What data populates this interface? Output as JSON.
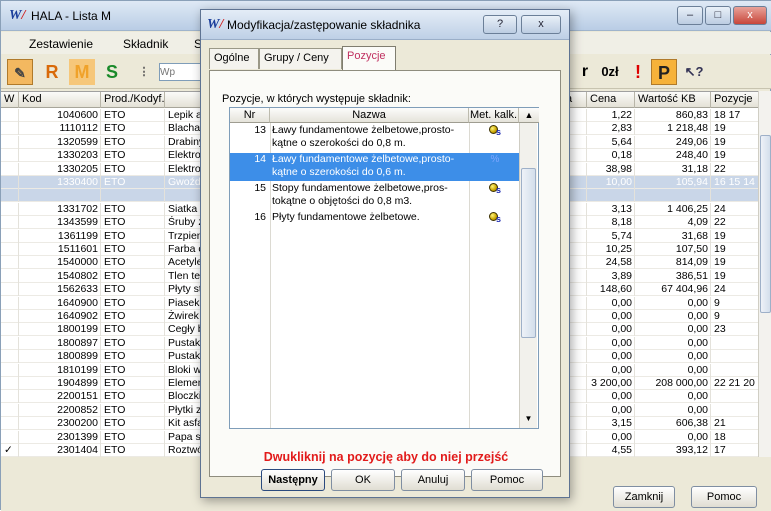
{
  "main": {
    "title": "HALA - Lista M",
    "menu": [
      "Zestawienie",
      "Składnik",
      "S"
    ],
    "toolbar": {
      "r_label": "R",
      "m_label": "M",
      "s_label": "S",
      "search_placeholder": "Wp",
      "right_r": "r",
      "currency": "0zł",
      "exclaim": "!",
      "p_label": "P",
      "help_glyph": "?"
    },
    "columns": [
      "W",
      "Kod",
      "Prod./Kodyf.",
      "",
      "a",
      "Cena",
      "Wartość KB",
      "Pozycje"
    ],
    "rows": [
      {
        "w": "",
        "kod": "1040600",
        "prod": "ETO",
        "name": "Lepik as",
        "a": "",
        "cena": "1,22",
        "wartosc": "860,83",
        "poz": "18 17"
      },
      {
        "w": "",
        "kod": "1110112",
        "prod": "ETO",
        "name": "Blacha",
        "a": "",
        "cena": "2,83",
        "wartosc": "1 218,48",
        "poz": "19"
      },
      {
        "w": "",
        "kod": "1320599",
        "prod": "ETO",
        "name": "Drabiny",
        "a": "",
        "cena": "5,64",
        "wartosc": "249,06",
        "poz": "19"
      },
      {
        "w": "",
        "kod": "1330203",
        "prod": "ETO",
        "name": "Elektrod",
        "a": "",
        "cena": "0,18",
        "wartosc": "248,40",
        "poz": "19"
      },
      {
        "w": "",
        "kod": "1330205",
        "prod": "ETO",
        "name": "Elektrod",
        "a": "",
        "cena": "38,98",
        "wartosc": "31,18",
        "poz": "22"
      },
      {
        "w": "",
        "kod": "1330400",
        "prod": "ETO",
        "name": "Gwoździ",
        "a": "",
        "cena": "10,00",
        "wartosc": "105,94",
        "poz": "16 15 14",
        "sel": true
      },
      {
        "w": "",
        "kod": "",
        "prod": "",
        "name": "",
        "a": "",
        "cena": "",
        "wartosc": "",
        "poz": "",
        "sel": true
      },
      {
        "w": "",
        "kod": "1331702",
        "prod": "ETO",
        "name": "Siatka F",
        "a": "",
        "cena": "3,13",
        "wartosc": "1 406,25",
        "poz": "24"
      },
      {
        "w": "",
        "kod": "1343599",
        "prod": "ETO",
        "name": "Śruby z",
        "a": "",
        "cena": "8,18",
        "wartosc": "4,09",
        "poz": "22"
      },
      {
        "w": "",
        "kod": "1361199",
        "prod": "ETO",
        "name": "Trzpieni",
        "a": "",
        "cena": "5,74",
        "wartosc": "31,68",
        "poz": "19"
      },
      {
        "w": "",
        "kod": "1511601",
        "prod": "ETO",
        "name": "Farba o",
        "a": "",
        "cena": "10,25",
        "wartosc": "107,50",
        "poz": "19"
      },
      {
        "w": "",
        "kod": "1540000",
        "prod": "ETO",
        "name": "Acetyler",
        "a": "",
        "cena": "24,58",
        "wartosc": "814,09",
        "poz": "19"
      },
      {
        "w": "",
        "kod": "1540802",
        "prod": "ETO",
        "name": "Tlen tec",
        "a": "",
        "cena": "3,89",
        "wartosc": "386,51",
        "poz": "19"
      },
      {
        "w": "",
        "kod": "1562633",
        "prod": "ETO",
        "name": "Płyty st",
        "a": "",
        "cena": "148,60",
        "wartosc": "67 404,96",
        "poz": "24"
      },
      {
        "w": "",
        "kod": "1640900",
        "prod": "ETO",
        "name": "Piasek",
        "a": "",
        "cena": "0,00",
        "wartosc": "0,00",
        "poz": "9"
      },
      {
        "w": "",
        "kod": "1640902",
        "prod": "ETO",
        "name": "Żwirek",
        "a": "",
        "cena": "0,00",
        "wartosc": "0,00",
        "poz": "9"
      },
      {
        "w": "",
        "kod": "1800199",
        "prod": "ETO",
        "name": "Cegły b",
        "a": "",
        "cena": "0,00",
        "wartosc": "0,00",
        "poz": "23"
      },
      {
        "w": "",
        "kod": "1800897",
        "prod": "ETO",
        "name": "Pustaki",
        "a": "",
        "cena": "0,00",
        "wartosc": "0,00",
        "poz": ""
      },
      {
        "w": "",
        "kod": "1800899",
        "prod": "ETO",
        "name": "Pustaki",
        "a": "",
        "cena": "0,00",
        "wartosc": "0,00",
        "poz": ""
      },
      {
        "w": "",
        "kod": "1810199",
        "prod": "ETO",
        "name": "Bloki wa",
        "a": "",
        "cena": "0,00",
        "wartosc": "0,00",
        "poz": ""
      },
      {
        "w": "",
        "kod": "1904899",
        "prod": "ETO",
        "name": "Element",
        "a": "",
        "cena": "3 200,00",
        "wartosc": "208 000,00",
        "poz": "22 21 20"
      },
      {
        "w": "",
        "kod": "2200151",
        "prod": "ETO",
        "name": "Bloczki",
        "a": "",
        "cena": "0,00",
        "wartosc": "0,00",
        "poz": ""
      },
      {
        "w": "",
        "kod": "2200852",
        "prod": "ETO",
        "name": "Płytki z",
        "a": "",
        "cena": "0,00",
        "wartosc": "0,00",
        "poz": ""
      },
      {
        "w": "",
        "kod": "2300200",
        "prod": "ETO",
        "name": "Kit asfal",
        "a": "",
        "cena": "3,15",
        "wartosc": "606,38",
        "poz": "21"
      },
      {
        "w": "",
        "kod": "2301399",
        "prod": "ETO",
        "name": "Papa sn",
        "a": "",
        "cena": "0,00",
        "wartosc": "0,00",
        "poz": "18"
      },
      {
        "w": "✓",
        "kod": "2301404",
        "prod": "ETO",
        "name": "Roztwó",
        "a": "",
        "cena": "4,55",
        "wartosc": "393,12",
        "poz": "17"
      }
    ],
    "buttons": {
      "zamknij": "Zamknij",
      "pomoc": "Pomoc"
    }
  },
  "dialog": {
    "title": "Modyfikacja/zastępowanie składnika",
    "help": "?",
    "close": "x",
    "tabs": [
      "Ogólne",
      "Grupy / Ceny",
      "Pozycje"
    ],
    "active_tab": 2,
    "list_label": "Pozycje, w których występuje składnik:",
    "columns": [
      "Nr",
      "Nazwa",
      "Met. kalk."
    ],
    "items": [
      {
        "nr": "13",
        "name": "Ławy fundamentowe żelbetowe,prosto-",
        "name2": "kątne o szerokości do 0,8 m.",
        "icon": "calc-s-icon",
        "sel": false
      },
      {
        "nr": "14",
        "name": "Ławy fundamentowe żelbetowe,prosto-",
        "name2": "kątne o szerokości do 0,6 m.",
        "icon": "percent-icon",
        "mark": "%",
        "sel": true
      },
      {
        "nr": "15",
        "name": "Stopy fundamentowe żelbetowe,pros-",
        "name2": "tokątne o objętości do 0,8 m3.",
        "icon": "calc-s-icon",
        "sel": false
      },
      {
        "nr": "16",
        "name": "Płyty fundamentowe żelbetowe.",
        "name2": "",
        "icon": "calc-s-icon",
        "sel": false
      }
    ],
    "icon_sub": "s",
    "hint": "Dwukliknij na pozycję aby do niej przejść",
    "buttons": {
      "next": "Następny",
      "ok": "OK",
      "cancel": "Anuluj",
      "help": "Pomoc"
    }
  },
  "colors": {
    "accent": "#3d8ee8",
    "hint": "#e21b1b",
    "tab_active": "#c03060"
  }
}
